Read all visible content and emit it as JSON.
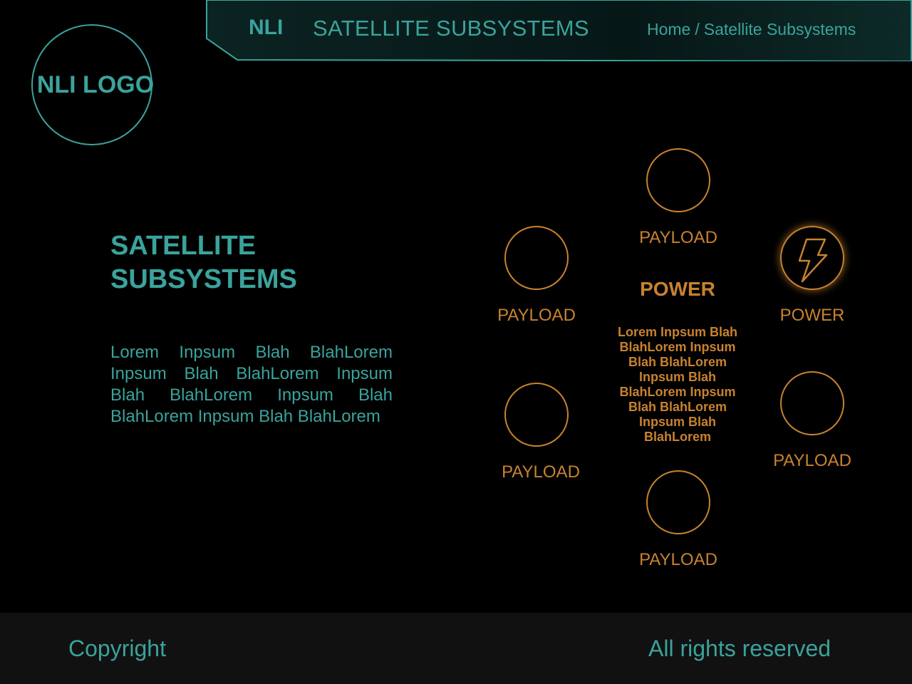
{
  "header": {
    "brand": "NLI",
    "title": "SATELLITE SUBSYSTEMS",
    "breadcrumb": {
      "home": "Home",
      "separator": "/",
      "current": "Satellite Subsystems"
    }
  },
  "logo": {
    "text": "NLI LOGO"
  },
  "hero": {
    "title": "SATELLITE SUBSYSTEMS",
    "body": "Lorem Inpsum Blah BlahLorem Inpsum Blah BlahLorem Inpsum Blah BlahLorem Inpsum Blah BlahLorem Inpsum Blah BlahLorem"
  },
  "subsystems": {
    "top": {
      "label": "PAYLOAD",
      "icon": ""
    },
    "upper_left": {
      "label": "PAYLOAD",
      "icon": ""
    },
    "upper_right": {
      "label": "POWER",
      "icon": "lightning-bolt-icon"
    },
    "lower_left": {
      "label": "PAYLOAD",
      "icon": ""
    },
    "lower_right": {
      "label": "PAYLOAD",
      "icon": ""
    },
    "bottom": {
      "label": "PAYLOAD",
      "icon": ""
    }
  },
  "detail": {
    "title": "POWER",
    "body": "Lorem Inpsum Blah BlahLorem Inpsum Blah BlahLorem Inpsum Blah BlahLorem Inpsum Blah BlahLorem Inpsum Blah BlahLorem"
  },
  "footer": {
    "copyright": "Copyright",
    "rights": "All rights reserved"
  },
  "colors": {
    "background": "#000000",
    "teal_accent": "#3aa39c",
    "orange_accent": "#c8822f",
    "footer_background": "#111111"
  }
}
